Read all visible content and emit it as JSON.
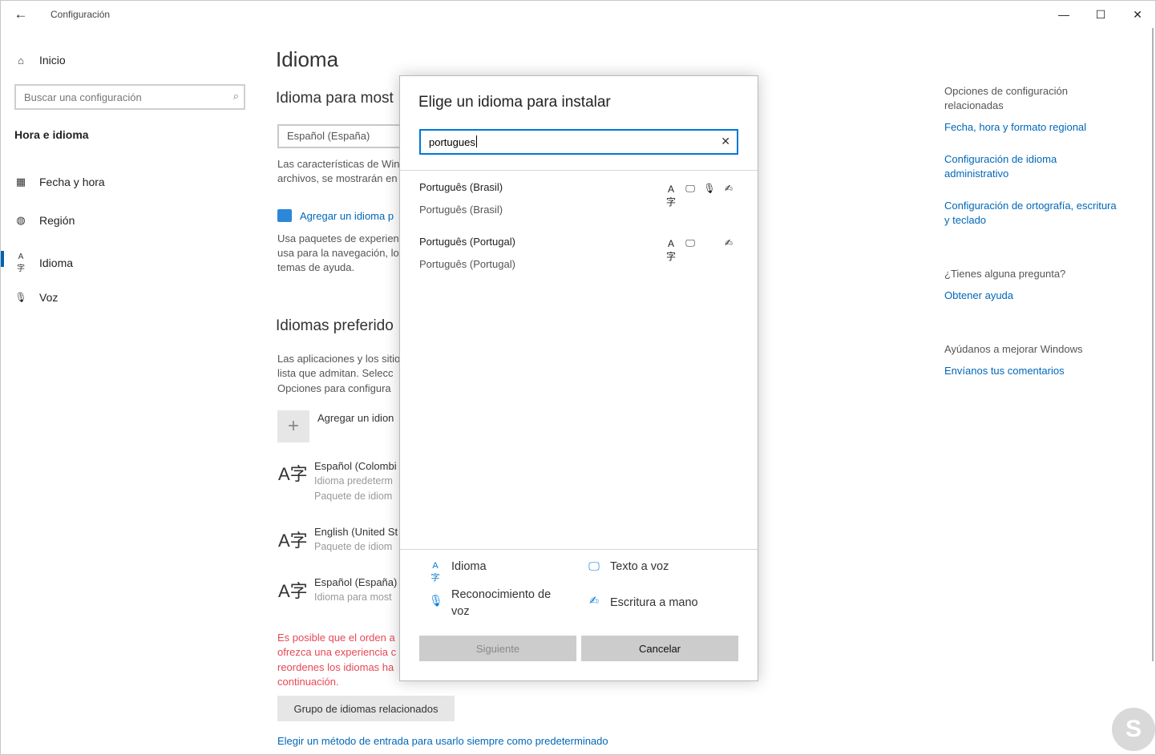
{
  "window": {
    "title": "Configuración",
    "back_glyph": "←",
    "minimize_glyph": "—",
    "maximize_glyph": "☐",
    "close_glyph": "✕"
  },
  "sidebar": {
    "home_label": "Inicio",
    "home_icon": "⌂",
    "search_placeholder": "Buscar una configuración",
    "search_icon": "⌕",
    "section_title": "Hora e idioma",
    "items": [
      {
        "label": "Fecha y hora",
        "icon": "calendar-clock-icon",
        "glyph": "▦"
      },
      {
        "label": "Región",
        "icon": "globe-icon",
        "glyph": "◍"
      },
      {
        "label": "Idioma",
        "icon": "language-icon",
        "glyph": "A字"
      },
      {
        "label": "Voz",
        "icon": "microphone-icon",
        "glyph": "🎙"
      }
    ],
    "active_index": 2,
    "accent_color": "#0063b1"
  },
  "main": {
    "title": "Idioma",
    "display_heading": "Idioma para most",
    "display_language_value": "Español (España)",
    "display_desc_1": "Las características de Win",
    "display_desc_2": "archivos, se mostrarán en",
    "store_link": "Agregar un idioma p",
    "store_desc_1": "Usa paquetes de experien",
    "store_desc_2": "usa para la navegación, lo",
    "store_desc_3": "temas de ayuda.",
    "preferred_heading": "Idiomas preferido",
    "preferred_desc_1": "Las aplicaciones y los sitio",
    "preferred_desc_2": "lista que admitan. Selecc",
    "preferred_desc_3": "Opciones para configura",
    "add_language_label": "Agregar un idion",
    "languages": [
      {
        "name": "Español (Colombi",
        "sub1": "Idioma predeterm",
        "sub2": "Paquete de idiom"
      },
      {
        "name": "English (United St",
        "sub1": "Paquete de idiom"
      },
      {
        "name": "Español (España)",
        "sub1": "Idioma para most"
      }
    ],
    "warning_1": "Es posible que el orden a",
    "warning_2": "ofrezca una experiencia c",
    "warning_3": "reordenes los idiomas ha",
    "warning_4": "continuación.",
    "warning_color": "#e74856",
    "group_button": "Grupo de idiomas relacionados",
    "input_method_link": "Elegir un método de entrada para usarlo siempre como predeterminado"
  },
  "related": {
    "heading_1": "Opciones de configuración",
    "heading_2": "relacionadas",
    "links": [
      "Fecha, hora y formato regional"
    ],
    "link_admin_1": "Configuración de idioma",
    "link_admin_2": "administrativo",
    "link_spell_1": "Configuración de ortografía, escritura",
    "link_spell_2": "y teclado",
    "question": "¿Tienes alguna pregunta?",
    "help_link": "Obtener ayuda",
    "improve": "Ayúdanos a mejorar Windows",
    "feedback_link": "Envíanos tus comentarios",
    "link_color": "#0067b8"
  },
  "dialog": {
    "title": "Elige un idioma para instalar",
    "search_value": "portugues",
    "clear_glyph": "✕",
    "results": [
      {
        "name": "Português (Brasil)",
        "native": "Português (Brasil)",
        "features": [
          "language-pack",
          "text-to-speech",
          "speech-recognition",
          "handwriting"
        ]
      },
      {
        "name": "Português (Portugal)",
        "native": "Português (Portugal)",
        "features": [
          "language-pack",
          "text-to-speech",
          "handwriting"
        ]
      }
    ],
    "legend": {
      "language": "Idioma",
      "tts": "Texto a voz",
      "speech_1": "Reconocimiento de",
      "speech_2": "voz",
      "handwriting": "Escritura a mano"
    },
    "next_button": "Siguiente",
    "cancel_button": "Cancelar",
    "focus_color": "#0078d7"
  },
  "watermark": "S"
}
